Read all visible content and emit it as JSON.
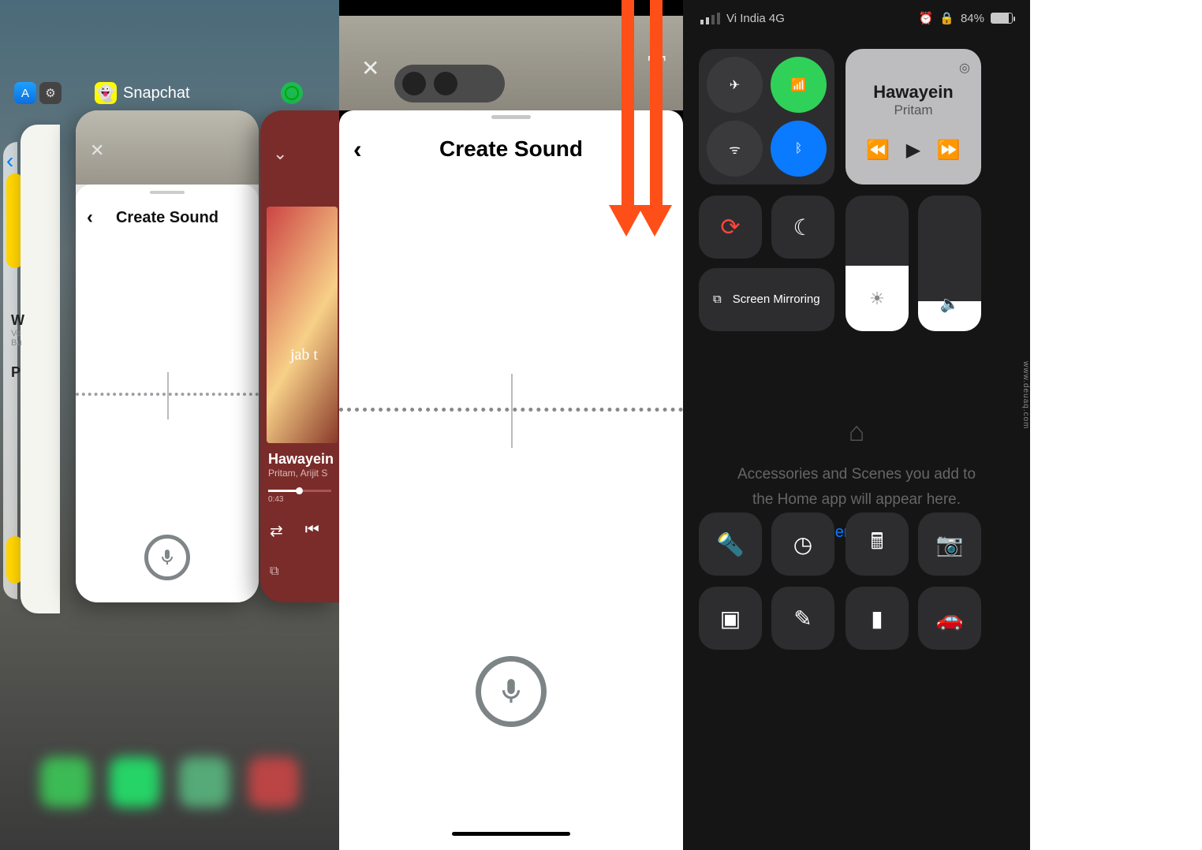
{
  "panel1": {
    "app_label": "Snapchat",
    "snap_card": {
      "title": "Create Sound"
    },
    "spotify": {
      "song": "Hawayein",
      "artist": "Pritam, Arijit S",
      "elapsed": "0:43"
    },
    "back_card": {
      "heading_initial": "W",
      "line1": "Ve",
      "line2": "Bu",
      "section": "P"
    }
  },
  "panel2": {
    "title": "Create Sound"
  },
  "panel3": {
    "status": {
      "carrier": "Vi India 4G",
      "battery_pct": "84%"
    },
    "music": {
      "song": "Hawayein",
      "artist": "Pritam"
    },
    "mirror_label": "Screen Mirroring",
    "home": {
      "text1": "Accessories and Scenes you add to",
      "text2": "the Home app will appear here.",
      "link": "Open Home"
    }
  }
}
